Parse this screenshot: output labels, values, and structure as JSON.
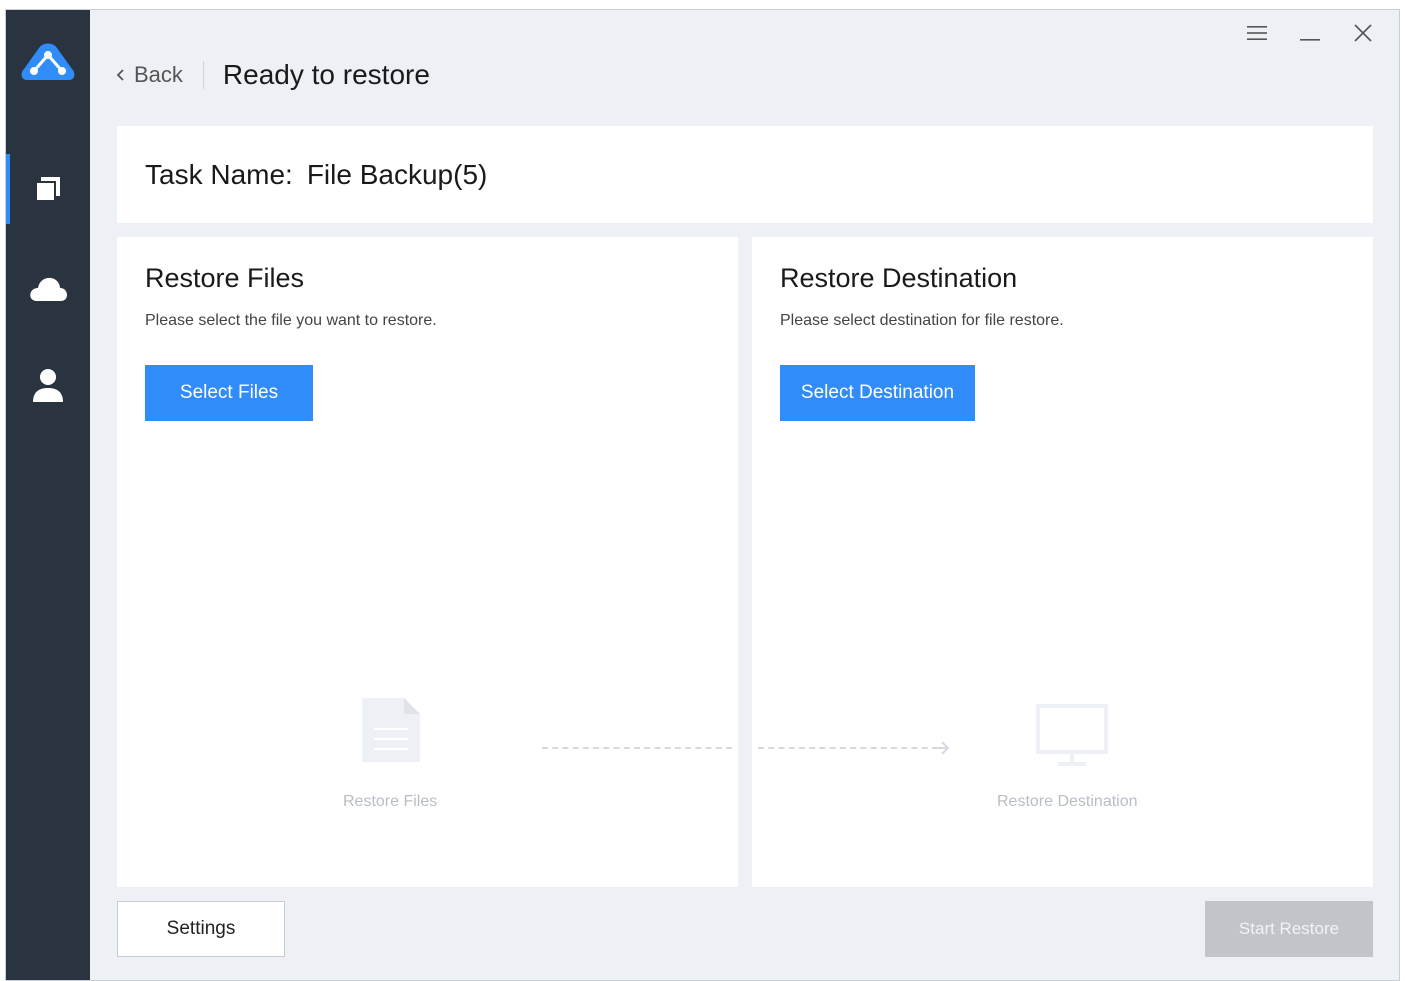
{
  "header": {
    "back_label": "Back",
    "title": "Ready to restore"
  },
  "task": {
    "label": "Task Name:",
    "name": "File Backup(5)"
  },
  "restore_files": {
    "title": "Restore Files",
    "description": "Please select the file you want to restore.",
    "button": "Select Files",
    "illustration_label": "Restore Files"
  },
  "restore_destination": {
    "title": "Restore Destination",
    "description": "Please select destination for file restore.",
    "button": "Select Destination",
    "illustration_label": "Restore Destination"
  },
  "footer": {
    "settings": "Settings",
    "start": "Start Restore"
  },
  "sidebar": {
    "items": [
      {
        "icon": "backup-copy-icon",
        "active": true
      },
      {
        "icon": "cloud-icon",
        "active": false
      },
      {
        "icon": "user-icon",
        "active": false
      }
    ]
  },
  "colors": {
    "accent": "#2f8cf8",
    "sidebar": "#2a3441",
    "background": "#edf0f4",
    "disabled": "#c1c4c8"
  }
}
